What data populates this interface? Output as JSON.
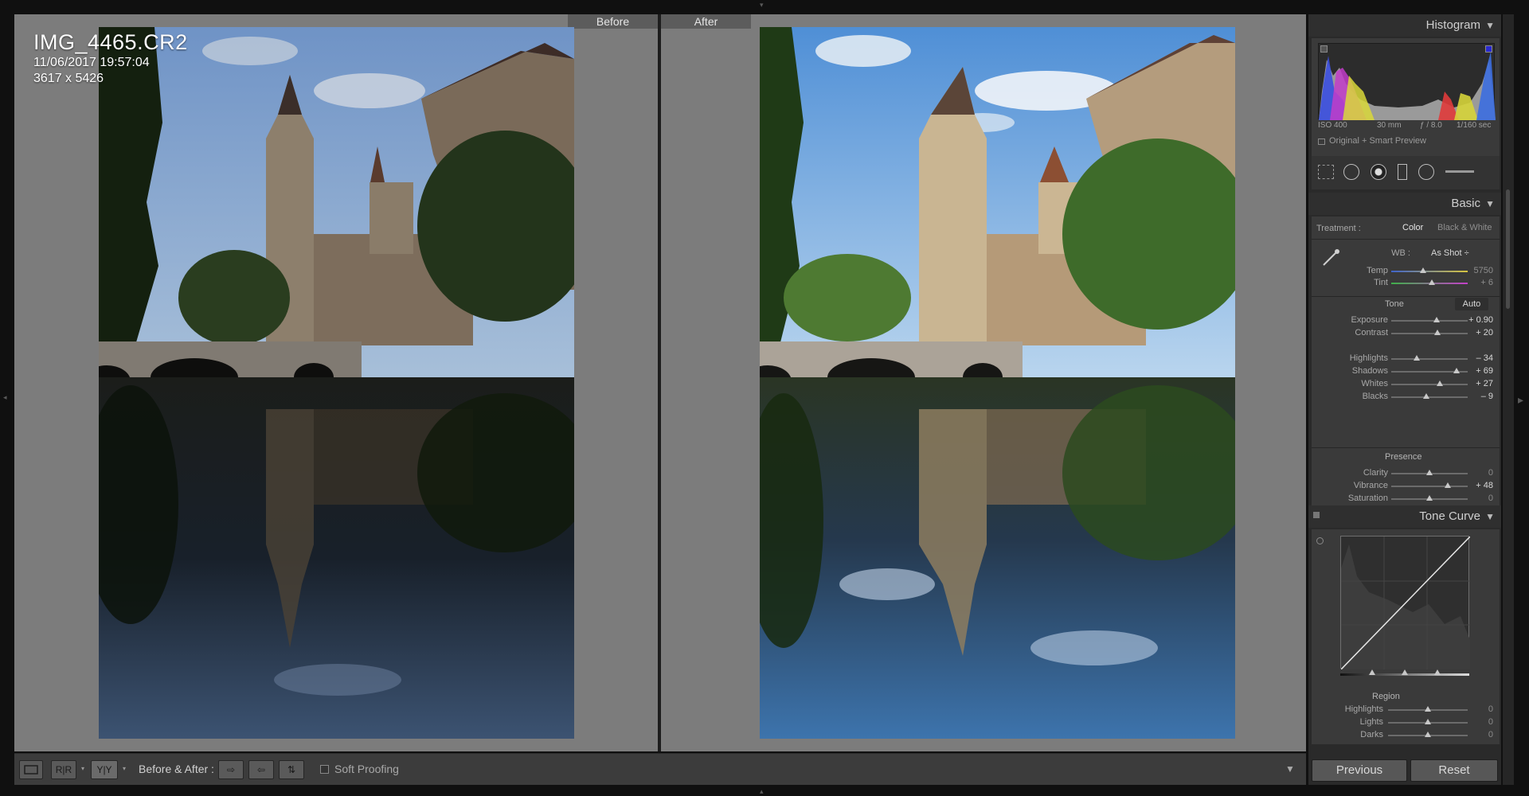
{
  "photo_info": {
    "filename": "IMG_4465.CR2",
    "datetime": "11/06/2017 19:57:04",
    "dimensions": "3617 x 5426"
  },
  "compare": {
    "before_label": "Before",
    "after_label": "After"
  },
  "toolbar": {
    "loupe_icon": "loupe-view-icon",
    "ab_label": "R|R",
    "yy_label": "Y|Y",
    "before_after_label": "Before & After :",
    "soft_proofing_label": "Soft Proofing"
  },
  "histogram": {
    "title": "Histogram",
    "iso": "ISO 400",
    "focal": "30 mm",
    "aperture": "ƒ / 8.0",
    "shutter": "1/160 sec",
    "preview_label": "Original + Smart Preview"
  },
  "basic": {
    "title": "Basic",
    "treatment_label": "Treatment :",
    "color_label": "Color",
    "bw_label": "Black & White",
    "wb_label": "WB :",
    "wb_value": "As Shot ÷",
    "temp": {
      "label": "Temp",
      "value": "5750",
      "pos": 0.42
    },
    "tint": {
      "label": "Tint",
      "value": "+ 6",
      "pos": 0.53
    },
    "tone_label": "Tone",
    "auto_label": "Auto",
    "tone_sliders": [
      {
        "label": "Exposure",
        "value": "+ 0.90",
        "pos": 0.59
      },
      {
        "label": "Contrast",
        "value": "+ 20",
        "pos": 0.6
      },
      {
        "label": "Highlights",
        "value": "– 34",
        "pos": 0.33
      },
      {
        "label": "Shadows",
        "value": "+ 69",
        "pos": 0.85
      },
      {
        "label": "Whites",
        "value": "+ 27",
        "pos": 0.64
      },
      {
        "label": "Blacks",
        "value": "– 9",
        "pos": 0.46
      }
    ],
    "presence_label": "Presence",
    "presence_sliders": [
      {
        "label": "Clarity",
        "value": "0",
        "pos": 0.5
      },
      {
        "label": "Vibrance",
        "value": "+ 48",
        "pos": 0.74
      },
      {
        "label": "Saturation",
        "value": "0",
        "pos": 0.5
      }
    ]
  },
  "tone_curve": {
    "title": "Tone Curve",
    "region_label": "Region",
    "sliders": [
      {
        "label": "Highlights",
        "value": "0",
        "pos": 0.5
      },
      {
        "label": "Lights",
        "value": "0",
        "pos": 0.5
      },
      {
        "label": "Darks",
        "value": "0",
        "pos": 0.5
      }
    ]
  },
  "footer": {
    "previous_label": "Previous",
    "reset_label": "Reset"
  }
}
